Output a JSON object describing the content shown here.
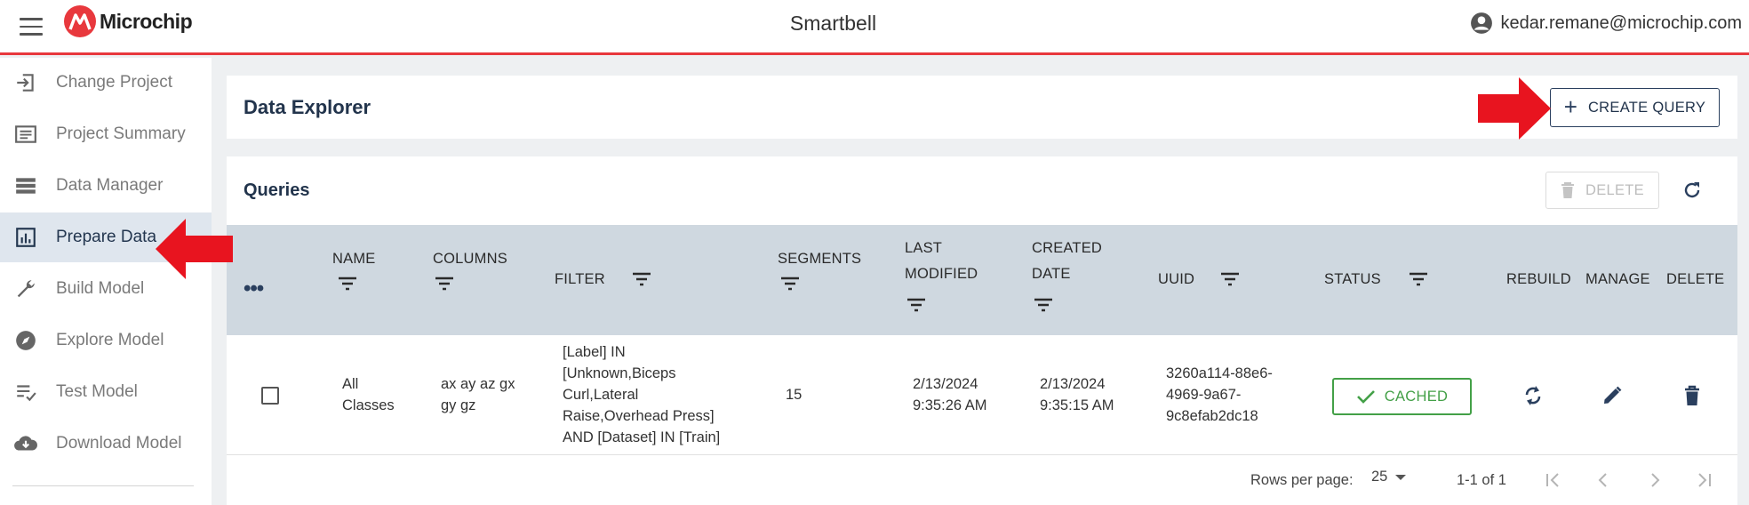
{
  "header": {
    "logo_text": "Microchip",
    "app_title": "Smartbell",
    "user_email": "kedar.remane@microchip.com"
  },
  "sidebar": {
    "items": [
      {
        "label": "Change Project",
        "icon": "login-icon",
        "active": false
      },
      {
        "label": "Project Summary",
        "icon": "summary-icon",
        "active": false
      },
      {
        "label": "Data Manager",
        "icon": "storage-icon",
        "active": false
      },
      {
        "label": "Prepare Data",
        "icon": "bar-chart-icon",
        "active": true
      },
      {
        "label": "Build Model",
        "icon": "wrench-icon",
        "active": false
      },
      {
        "label": "Explore Model",
        "icon": "compass-icon",
        "active": false
      },
      {
        "label": "Test Model",
        "icon": "checklist-icon",
        "active": false
      },
      {
        "label": "Download Model",
        "icon": "cloud-download-icon",
        "active": false
      }
    ]
  },
  "explorer": {
    "title": "Data Explorer",
    "create_label": "CREATE QUERY"
  },
  "queries": {
    "title": "Queries",
    "delete_label": "DELETE",
    "columns": {
      "name": "NAME",
      "columns": "COLUMNS",
      "filter": "FILTER",
      "segments": "SEGMENTS",
      "last_modified_1": "LAST",
      "last_modified_2": "MODIFIED",
      "created_1": "CREATED",
      "created_2": "DATE",
      "uuid": "UUID",
      "status": "STATUS",
      "rebuild": "REBUILD",
      "manage": "MANAGE",
      "delete": "DELETE"
    },
    "rows": [
      {
        "name_1": "All",
        "name_2": "Classes",
        "columns_1": "ax ay az gx",
        "columns_2": "gy gz",
        "filter_1": "[Label] IN",
        "filter_2": "[Unknown,Biceps",
        "filter_3": "Curl,Lateral",
        "filter_4": "Raise,Overhead Press]",
        "filter_5": "AND [Dataset] IN [Train]",
        "segments": "15",
        "last_modified_1": "2/13/2024",
        "last_modified_2": "9:35:26 AM",
        "created_1": "2/13/2024",
        "created_2": "9:35:15 AM",
        "uuid_1": "3260a114-88e6-",
        "uuid_2": "4969-9a67-",
        "uuid_3": "9c8efab2dc18",
        "status": "CACHED"
      }
    ]
  },
  "pagination": {
    "rows_per_page_label": "Rows per page:",
    "rows_per_page": "25",
    "range": "1-1 of 1"
  },
  "colors": {
    "brand_red": "#e8383d",
    "navy": "#22344c",
    "header_bg": "#cfd8e0",
    "status_green": "#43a047"
  }
}
